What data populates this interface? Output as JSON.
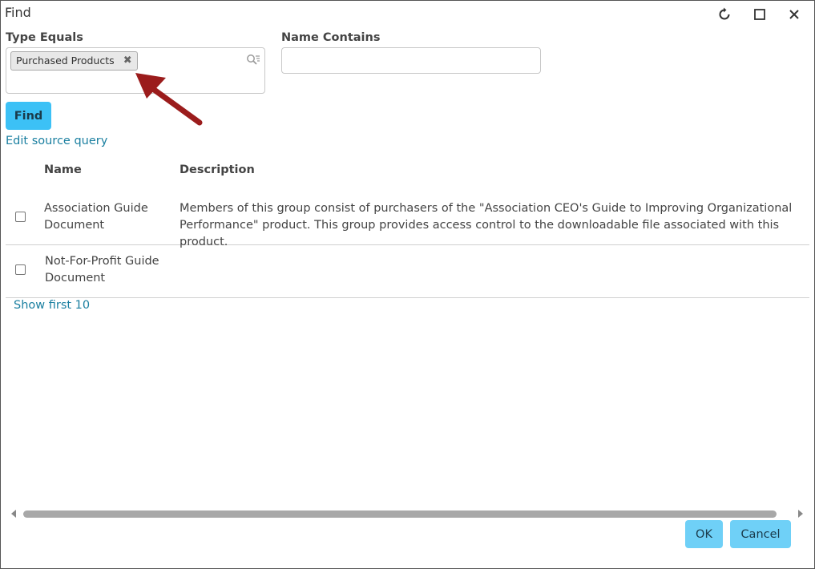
{
  "window": {
    "title": "Find",
    "refresh_icon": "refresh-icon",
    "maximize_icon": "maximize-icon",
    "close_icon": "close-icon"
  },
  "filters": {
    "type_label": "Type Equals",
    "type_selected_tag": "Purchased Products",
    "type_remove_glyph": "✖",
    "search_icon": "search-filter-icon",
    "name_label": "Name Contains",
    "name_value": ""
  },
  "actions": {
    "find_label": "Find",
    "edit_source_label": "Edit source query"
  },
  "table": {
    "columns": [
      "Name",
      "Description"
    ],
    "rows": [
      {
        "name": "Association Guide Document",
        "description": "Members of this group consist of purchasers of the \"Association CEO's Guide to Improving Organizational Performance\" product. This group provides access control to the downloadable file associated with this product.",
        "checked": false
      },
      {
        "name": "Not-For-Profit Guide Document",
        "description": "",
        "checked": false
      }
    ],
    "show_more_label": "Show first 10"
  },
  "footer": {
    "ok_label": "OK",
    "cancel_label": "Cancel"
  },
  "colors": {
    "accent_button": "#3cc1f6",
    "footer_button": "#6fd0f7",
    "link": "#1a7fa0",
    "annotation_arrow": "#9b1c1c"
  }
}
